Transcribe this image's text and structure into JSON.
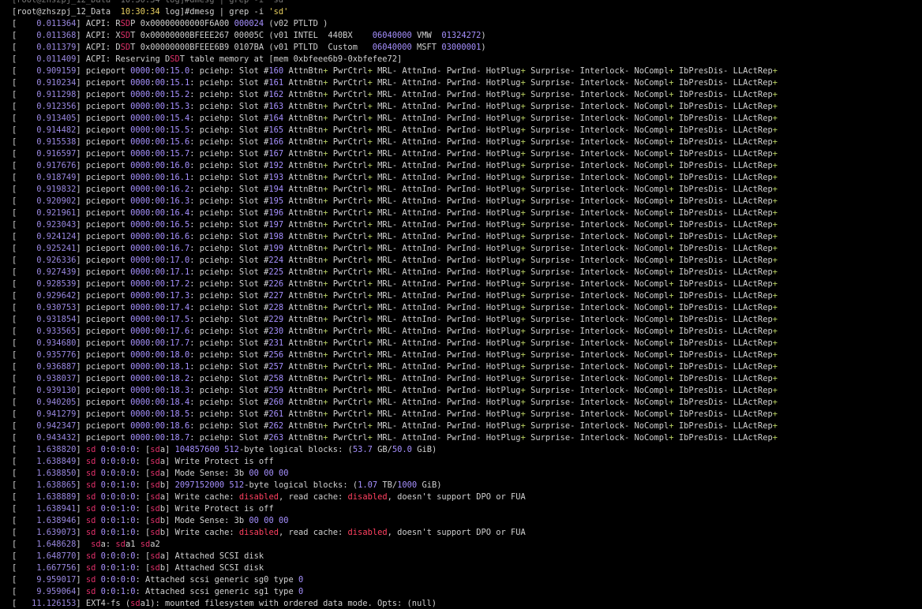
{
  "palette": {
    "background": "#000000",
    "text": "#d0d0d0",
    "timestamp": "#9a88e0",
    "match_highlight": "#e0306a",
    "value": "#a690ff",
    "plus_flag": "#b8d060",
    "quoted": "#e8d060",
    "disabled": "#ff4060"
  },
  "terminal": {
    "top_partial": "[root@zhszpj_12_Data  10:30:34 log]#dmesg | grep -i 'sd'",
    "prompt": {
      "user_host": "[root@zhszpj_12_Data",
      "time": "10:30:34",
      "dir": "log]#",
      "command": "dmesg | grep -i 'sd'"
    },
    "lines": [
      "[    0.011364] ACPI: RSDP 0x00000000000F6A00 000024 (v02 PTLTD )",
      "[    0.011368] ACPI: XSDT 0x00000000BFEEE267 00005C (v01 INTEL  440BX    06040000 VMW  01324272)",
      "[    0.011379] ACPI: DSDT 0x00000000BFEEE6B9 0107BA (v01 PTLTD  Custom   06040000 MSFT 03000001)",
      "[    0.011409] ACPI: Reserving DSDT table memory at [mem 0xbfeee6b9-0xbfefee72]",
      "[    0.909159] pcieport 0000:00:15.0: pciehp: Slot #160 AttnBtn+ PwrCtrl+ MRL- AttnInd- PwrInd- HotPlug+ Surprise- Interlock- NoCompl+ IbPresDis- LLActRep+",
      "[    0.910234] pcieport 0000:00:15.1: pciehp: Slot #161 AttnBtn+ PwrCtrl+ MRL- AttnInd- PwrInd- HotPlug+ Surprise- Interlock- NoCompl+ IbPresDis- LLActRep+",
      "[    0.911298] pcieport 0000:00:15.2: pciehp: Slot #162 AttnBtn+ PwrCtrl+ MRL- AttnInd- PwrInd- HotPlug+ Surprise- Interlock- NoCompl+ IbPresDis- LLActRep+",
      "[    0.912356] pcieport 0000:00:15.3: pciehp: Slot #163 AttnBtn+ PwrCtrl+ MRL- AttnInd- PwrInd- HotPlug+ Surprise- Interlock- NoCompl+ IbPresDis- LLActRep+",
      "[    0.913405] pcieport 0000:00:15.4: pciehp: Slot #164 AttnBtn+ PwrCtrl+ MRL- AttnInd- PwrInd- HotPlug+ Surprise- Interlock- NoCompl+ IbPresDis- LLActRep+",
      "[    0.914482] pcieport 0000:00:15.5: pciehp: Slot #165 AttnBtn+ PwrCtrl+ MRL- AttnInd- PwrInd- HotPlug+ Surprise- Interlock- NoCompl+ IbPresDis- LLActRep+",
      "[    0.915538] pcieport 0000:00:15.6: pciehp: Slot #166 AttnBtn+ PwrCtrl+ MRL- AttnInd- PwrInd- HotPlug+ Surprise- Interlock- NoCompl+ IbPresDis- LLActRep+",
      "[    0.916597] pcieport 0000:00:15.7: pciehp: Slot #167 AttnBtn+ PwrCtrl+ MRL- AttnInd- PwrInd- HotPlug+ Surprise- Interlock- NoCompl+ IbPresDis- LLActRep+",
      "[    0.917676] pcieport 0000:00:16.0: pciehp: Slot #192 AttnBtn+ PwrCtrl+ MRL- AttnInd- PwrInd- HotPlug+ Surprise- Interlock- NoCompl+ IbPresDis- LLActRep+",
      "[    0.918749] pcieport 0000:00:16.1: pciehp: Slot #193 AttnBtn+ PwrCtrl+ MRL- AttnInd- PwrInd- HotPlug+ Surprise- Interlock- NoCompl+ IbPresDis- LLActRep+",
      "[    0.919832] pcieport 0000:00:16.2: pciehp: Slot #194 AttnBtn+ PwrCtrl+ MRL- AttnInd- PwrInd- HotPlug+ Surprise- Interlock- NoCompl+ IbPresDis- LLActRep+",
      "[    0.920902] pcieport 0000:00:16.3: pciehp: Slot #195 AttnBtn+ PwrCtrl+ MRL- AttnInd- PwrInd- HotPlug+ Surprise- Interlock- NoCompl+ IbPresDis- LLActRep+",
      "[    0.921961] pcieport 0000:00:16.4: pciehp: Slot #196 AttnBtn+ PwrCtrl+ MRL- AttnInd- PwrInd- HotPlug+ Surprise- Interlock- NoCompl+ IbPresDis- LLActRep+",
      "[    0.923043] pcieport 0000:00:16.5: pciehp: Slot #197 AttnBtn+ PwrCtrl+ MRL- AttnInd- PwrInd- HotPlug+ Surprise- Interlock- NoCompl+ IbPresDis- LLActRep+",
      "[    0.924124] pcieport 0000:00:16.6: pciehp: Slot #198 AttnBtn+ PwrCtrl+ MRL- AttnInd- PwrInd- HotPlug+ Surprise- Interlock- NoCompl+ IbPresDis- LLActRep+",
      "[    0.925241] pcieport 0000:00:16.7: pciehp: Slot #199 AttnBtn+ PwrCtrl+ MRL- AttnInd- PwrInd- HotPlug+ Surprise- Interlock- NoCompl+ IbPresDis- LLActRep+",
      "[    0.926336] pcieport 0000:00:17.0: pciehp: Slot #224 AttnBtn+ PwrCtrl+ MRL- AttnInd- PwrInd- HotPlug+ Surprise- Interlock- NoCompl+ IbPresDis- LLActRep+",
      "[    0.927439] pcieport 0000:00:17.1: pciehp: Slot #225 AttnBtn+ PwrCtrl+ MRL- AttnInd- PwrInd- HotPlug+ Surprise- Interlock- NoCompl+ IbPresDis- LLActRep+",
      "[    0.928539] pcieport 0000:00:17.2: pciehp: Slot #226 AttnBtn+ PwrCtrl+ MRL- AttnInd- PwrInd- HotPlug+ Surprise- Interlock- NoCompl+ IbPresDis- LLActRep+",
      "[    0.929642] pcieport 0000:00:17.3: pciehp: Slot #227 AttnBtn+ PwrCtrl+ MRL- AttnInd- PwrInd- HotPlug+ Surprise- Interlock- NoCompl+ IbPresDis- LLActRep+",
      "[    0.930753] pcieport 0000:00:17.4: pciehp: Slot #228 AttnBtn+ PwrCtrl+ MRL- AttnInd- PwrInd- HotPlug+ Surprise- Interlock- NoCompl+ IbPresDis- LLActRep+",
      "[    0.931854] pcieport 0000:00:17.5: pciehp: Slot #229 AttnBtn+ PwrCtrl+ MRL- AttnInd- PwrInd- HotPlug+ Surprise- Interlock- NoCompl+ IbPresDis- LLActRep+",
      "[    0.933565] pcieport 0000:00:17.6: pciehp: Slot #230 AttnBtn+ PwrCtrl+ MRL- AttnInd- PwrInd- HotPlug+ Surprise- Interlock- NoCompl+ IbPresDis- LLActRep+",
      "[    0.934680] pcieport 0000:00:17.7: pciehp: Slot #231 AttnBtn+ PwrCtrl+ MRL- AttnInd- PwrInd- HotPlug+ Surprise- Interlock- NoCompl+ IbPresDis- LLActRep+",
      "[    0.935776] pcieport 0000:00:18.0: pciehp: Slot #256 AttnBtn+ PwrCtrl+ MRL- AttnInd- PwrInd- HotPlug+ Surprise- Interlock- NoCompl+ IbPresDis- LLActRep+",
      "[    0.936887] pcieport 0000:00:18.1: pciehp: Slot #257 AttnBtn+ PwrCtrl+ MRL- AttnInd- PwrInd- HotPlug+ Surprise- Interlock- NoCompl+ IbPresDis- LLActRep+",
      "[    0.938037] pcieport 0000:00:18.2: pciehp: Slot #258 AttnBtn+ PwrCtrl+ MRL- AttnInd- PwrInd- HotPlug+ Surprise- Interlock- NoCompl+ IbPresDis- LLActRep+",
      "[    0.939130] pcieport 0000:00:18.3: pciehp: Slot #259 AttnBtn+ PwrCtrl+ MRL- AttnInd- PwrInd- HotPlug+ Surprise- Interlock- NoCompl+ IbPresDis- LLActRep+",
      "[    0.940205] pcieport 0000:00:18.4: pciehp: Slot #260 AttnBtn+ PwrCtrl+ MRL- AttnInd- PwrInd- HotPlug+ Surprise- Interlock- NoCompl+ IbPresDis- LLActRep+",
      "[    0.941279] pcieport 0000:00:18.5: pciehp: Slot #261 AttnBtn+ PwrCtrl+ MRL- AttnInd- PwrInd- HotPlug+ Surprise- Interlock- NoCompl+ IbPresDis- LLActRep+",
      "[    0.942347] pcieport 0000:00:18.6: pciehp: Slot #262 AttnBtn+ PwrCtrl+ MRL- AttnInd- PwrInd- HotPlug+ Surprise- Interlock- NoCompl+ IbPresDis- LLActRep+",
      "[    0.943432] pcieport 0000:00:18.7: pciehp: Slot #263 AttnBtn+ PwrCtrl+ MRL- AttnInd- PwrInd- HotPlug+ Surprise- Interlock- NoCompl+ IbPresDis- LLActRep+",
      "[    1.638820] sd 0:0:0:0: [sda] 104857600 512-byte logical blocks: (53.7 GB/50.0 GiB)",
      "[    1.638849] sd 0:0:0:0: [sda] Write Protect is off",
      "[    1.638850] sd 0:0:0:0: [sda] Mode Sense: 3b 00 00 00",
      "[    1.638865] sd 0:0:1:0: [sdb] 2097152000 512-byte logical blocks: (1.07 TB/1000 GiB)",
      "[    1.638889] sd 0:0:0:0: [sda] Write cache: disabled, read cache: disabled, doesn't support DPO or FUA",
      "[    1.638941] sd 0:0:1:0: [sdb] Write Protect is off",
      "[    1.638946] sd 0:0:1:0: [sdb] Mode Sense: 3b 00 00 00",
      "[    1.639073] sd 0:0:1:0: [sdb] Write cache: disabled, read cache: disabled, doesn't support DPO or FUA",
      "[    1.648628]  sda: sda1 sda2",
      "[    1.648770] sd 0:0:0:0: [sda] Attached SCSI disk",
      "[    1.667756] sd 0:0:1:0: [sdb] Attached SCSI disk",
      "[    9.959017] sd 0:0:0:0: Attached scsi generic sg0 type 0",
      "[    9.959064] sd 0:0:1:0: Attached scsi generic sg1 type 0",
      "[   11.126153] EXT4-fs (sda1): mounted filesystem with ordered data mode. Opts: (null)"
    ]
  }
}
